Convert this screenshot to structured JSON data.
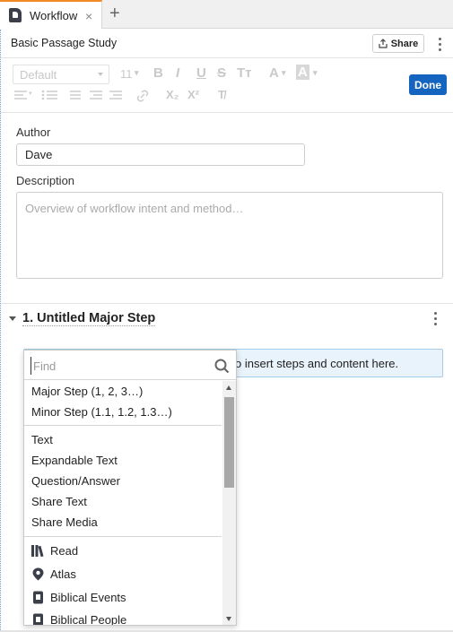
{
  "tab": {
    "label": "Workflow",
    "close_glyph": "×",
    "add_glyph": "+"
  },
  "header": {
    "title": "Basic Passage Study",
    "share_label": "Share"
  },
  "toolbar": {
    "font_family": "Default",
    "font_size": "11",
    "done_label": "Done"
  },
  "form": {
    "author_label": "Author",
    "author_value": "Dave",
    "description_label": "Description",
    "description_placeholder": "Overview of workflow intent and method…"
  },
  "step": {
    "title": "1. Untitled Major Step",
    "insert_hint": "o insert steps and content here."
  },
  "dropdown": {
    "find_placeholder": "Find",
    "structure_items": [
      "Major Step (1, 2, 3…)",
      "Minor Step (1.1, 1.2, 1.3…)"
    ],
    "content_items": [
      "Text",
      "Expandable Text",
      "Question/Answer",
      "Share Text",
      "Share Media"
    ],
    "tool_items": [
      {
        "label": "Read",
        "icon": "books-icon"
      },
      {
        "label": "Atlas",
        "icon": "map-pin-icon"
      },
      {
        "label": "Biblical Events",
        "icon": "document-icon"
      },
      {
        "label": "Biblical People",
        "icon": "document-icon"
      }
    ]
  },
  "colors": {
    "accent": "#1565c0",
    "tab_highlight": "#f08a24",
    "insert_bg": "#e8f3fb"
  }
}
